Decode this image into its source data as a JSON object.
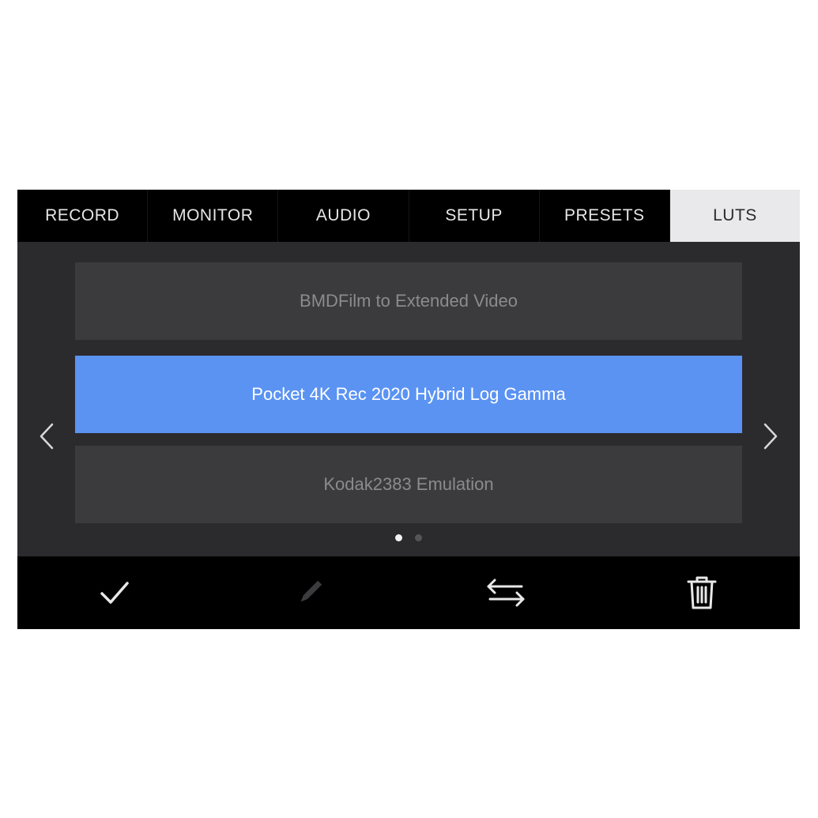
{
  "tabs": [
    {
      "label": "RECORD"
    },
    {
      "label": "MONITOR"
    },
    {
      "label": "AUDIO"
    },
    {
      "label": "SETUP"
    },
    {
      "label": "PRESETS"
    },
    {
      "label": "LUTS",
      "active": true
    }
  ],
  "lut_list": {
    "items": [
      {
        "label": "BMDFilm to Extended Video"
      },
      {
        "label": "Pocket 4K Rec 2020 Hybrid Log Gamma",
        "selected": true
      },
      {
        "label": "Kodak2383 Emulation"
      }
    ],
    "page_current": 1,
    "page_total": 2
  },
  "icons": {
    "prev": "chevron-left-icon",
    "next": "chevron-right-icon",
    "apply": "checkmark-icon",
    "edit": "pencil-icon",
    "import_export": "swap-arrows-icon",
    "delete": "trash-icon"
  },
  "colors": {
    "selected": "#5b93f3",
    "active_tab": "#e9e9eb",
    "row": "#3b3b3d",
    "background": "#2b2b2d"
  }
}
